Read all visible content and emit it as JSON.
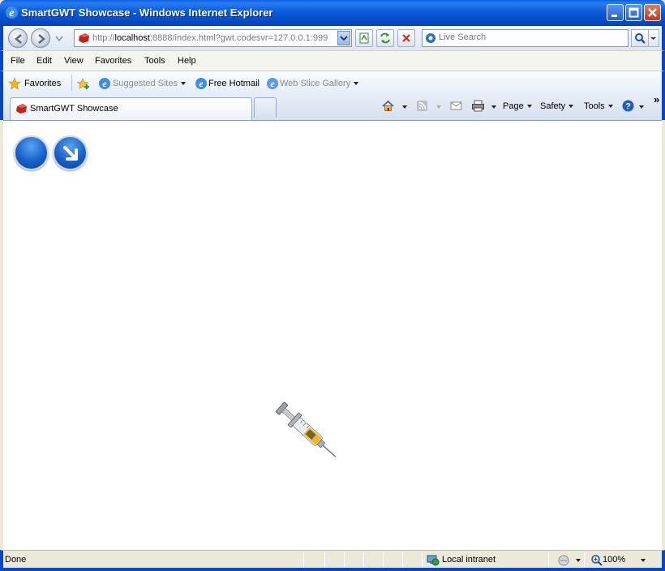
{
  "window": {
    "title": "SmartGWT Showcase - Windows Internet Explorer"
  },
  "address_bar": {
    "url_prefix": "http://",
    "url_host": "localhost",
    "url_rest": ":8888/index.html?gwt.codesvr=127.0.0.1:999",
    "search_placeholder": "Live Search"
  },
  "menu": {
    "items": [
      "File",
      "Edit",
      "View",
      "Favorites",
      "Tools",
      "Help"
    ]
  },
  "favorites_bar": {
    "favorites_label": "Favorites",
    "suggested_sites": "Suggested Sites",
    "free_hotmail": "Free Hotmail",
    "web_slice_gallery": "Web Slice Gallery"
  },
  "tabs": {
    "active_tab_label": "SmartGWT Showcase"
  },
  "command_bar": {
    "page": "Page",
    "safety": "Safety",
    "tools": "Tools",
    "overflow": "»"
  },
  "status_bar": {
    "status": "Done",
    "zone": "Local intranet",
    "zoom": "100%"
  },
  "colors": {
    "titlebar_blue": "#0648c4",
    "button_blue": "#1761c8",
    "content_bg": "#ffffff"
  },
  "icons": {
    "content_button_1": "blue-circle-icon",
    "content_button_2": "arrow-down-right-icon",
    "content_image": "syringe-icon"
  }
}
